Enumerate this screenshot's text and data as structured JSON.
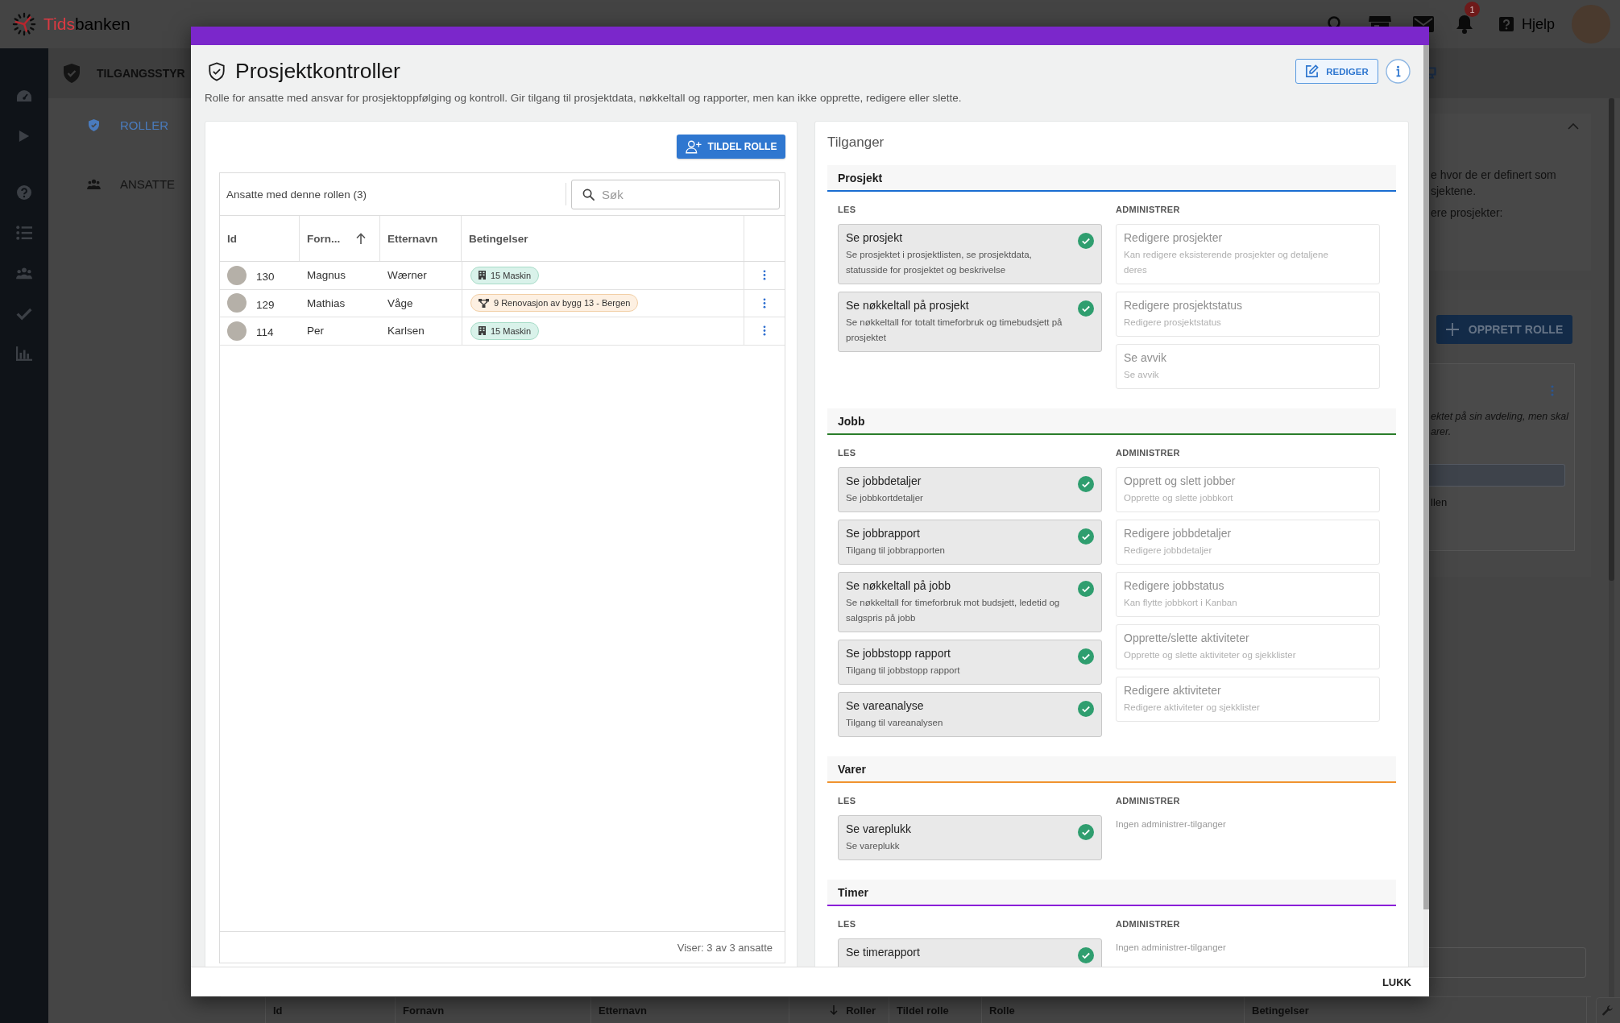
{
  "top_bar": {
    "logo": {
      "part_1": "Tids",
      "part_2": "banken"
    },
    "notification_count": "1",
    "help_label": "Hjelp"
  },
  "page_header": {
    "title": "TILGANGSSTYR"
  },
  "sub_nav": [
    {
      "label": "ROLLER",
      "selected": true
    },
    {
      "label": "ANSATTE",
      "selected": false
    }
  ],
  "background": {
    "info_lines": [
      "e hvor de er definert som",
      "sjektene."
    ],
    "info_line_2": "ere prosjekter:",
    "create_button": "OPPRETT ROLLE",
    "role_card_lines": [
      "ektet på sin avdeling, men skal",
      "arer."
    ],
    "role_card_caption": "llen",
    "table_columns": [
      {
        "label": "Id"
      },
      {
        "label": "Fornavn"
      },
      {
        "label": "Etternavn"
      },
      {
        "label": "Roller",
        "sorted": true,
        "descending": true
      },
      {
        "label": "Tildel rolle"
      },
      {
        "label": "Rolle"
      },
      {
        "label": "Betingelser"
      }
    ]
  },
  "modal": {
    "title": "Prosjektkontroller",
    "description": "Rolle for ansatte med ansvar for prosjektoppfølging og kontroll. Gir tilgang til prosjektdata, nøkkeltall og rapporter, men kan ikke opprette, redigere eller slette.",
    "edit_button": "REDIGER",
    "assign_button": "TILDEL ROLLE",
    "employees": {
      "heading": "Ansatte med denne rollen (3)",
      "search": {
        "placeholder": "Søk"
      },
      "columns": [
        {
          "label": "Id"
        },
        {
          "label": "Forn...",
          "sorted": true,
          "descending": false
        },
        {
          "label": "Etternavn"
        },
        {
          "label": "Betingelser"
        }
      ],
      "rows": [
        {
          "id": "130",
          "first_name": "Magnus",
          "last_name": "Wærner",
          "conditions": [
            {
              "label": "15 Maskin",
              "kind": "department"
            }
          ]
        },
        {
          "id": "129",
          "first_name": "Mathias",
          "last_name": "Våge",
          "conditions": [
            {
              "label": "9 Renovasjon av bygg 13 - Bergen",
              "kind": "project"
            }
          ]
        },
        {
          "id": "114",
          "first_name": "Per",
          "last_name": "Karlsen",
          "conditions": [
            {
              "label": "15 Maskin",
              "kind": "department"
            }
          ]
        }
      ],
      "footer": "Viser: 3 av 3 ansatte"
    },
    "permissions": {
      "heading": "Tilganger",
      "sections": [
        {
          "title": "Prosjekt",
          "color": "#1a6dd1",
          "read": {
            "label": "LES",
            "items": [
              {
                "title": "Se prosjekt",
                "description": "Se prosjektet i prosjektlisten, se prosjektdata, statusside for prosjektet og beskrivelse",
                "granted": true
              },
              {
                "title": "Se nøkkeltall på prosjekt",
                "description": "Se nøkkeltall for totalt timeforbruk og timebudsjett på prosjektet",
                "granted": true
              }
            ]
          },
          "admin": {
            "label": "ADMINISTRER",
            "items": [
              {
                "title": "Redigere prosjekter",
                "description": "Kan redigere eksisterende prosjekter og detaljene deres",
                "granted": false
              },
              {
                "title": "Redigere prosjektstatus",
                "description": "Redigere prosjektstatus",
                "granted": false
              },
              {
                "title": "Se avvik",
                "description": "Se avvik",
                "granted": false
              }
            ]
          }
        },
        {
          "title": "Jobb",
          "color": "#2a7d2a",
          "read": {
            "label": "LES",
            "items": [
              {
                "title": "Se jobbdetaljer",
                "description": "Se jobbkortdetaljer",
                "granted": true
              },
              {
                "title": "Se jobbrapport",
                "description": "Tilgang til jobbrapporten",
                "granted": true
              },
              {
                "title": "Se nøkkeltall på jobb",
                "description": "Se nøkkeltall for timeforbruk mot budsjett, ledetid og salgspris på jobb",
                "granted": true
              },
              {
                "title": "Se jobbstopp rapport",
                "description": "Tilgang til jobbstopp rapport",
                "granted": true
              },
              {
                "title": "Se vareanalyse",
                "description": "Tilgang til vareanalysen",
                "granted": true
              }
            ]
          },
          "admin": {
            "label": "ADMINISTRER",
            "items": [
              {
                "title": "Opprett og slett jobber",
                "description": "Opprette og slette jobbkort",
                "granted": false
              },
              {
                "title": "Redigere jobbdetaljer",
                "description": "Redigere jobbdetaljer",
                "granted": false
              },
              {
                "title": "Redigere jobbstatus",
                "description": "Kan flytte jobbkort i Kanban",
                "granted": false
              },
              {
                "title": "Opprette/slette aktiviteter",
                "description": "Opprette og slette aktiviteter og sjekklister",
                "granted": false
              },
              {
                "title": "Redigere aktiviteter",
                "description": "Redigere aktiviteter og sjekklister",
                "granted": false
              }
            ]
          }
        },
        {
          "title": "Varer",
          "color": "#f0932f",
          "read": {
            "label": "LES",
            "items": [
              {
                "title": "Se vareplukk",
                "description": "Se vareplukk",
                "granted": true
              }
            ]
          },
          "admin": {
            "label": "ADMINISTRER",
            "empty_text": "Ingen administrer-tilganger"
          }
        },
        {
          "title": "Timer",
          "color": "#8a1fd8",
          "read": {
            "label": "LES",
            "items": [
              {
                "title": "Se timerapport",
                "granted": true
              }
            ]
          },
          "admin": {
            "label": "ADMINISTRER",
            "empty_text": "Ingen administrer-tilganger"
          }
        }
      ]
    },
    "close_button": "LUKK"
  }
}
